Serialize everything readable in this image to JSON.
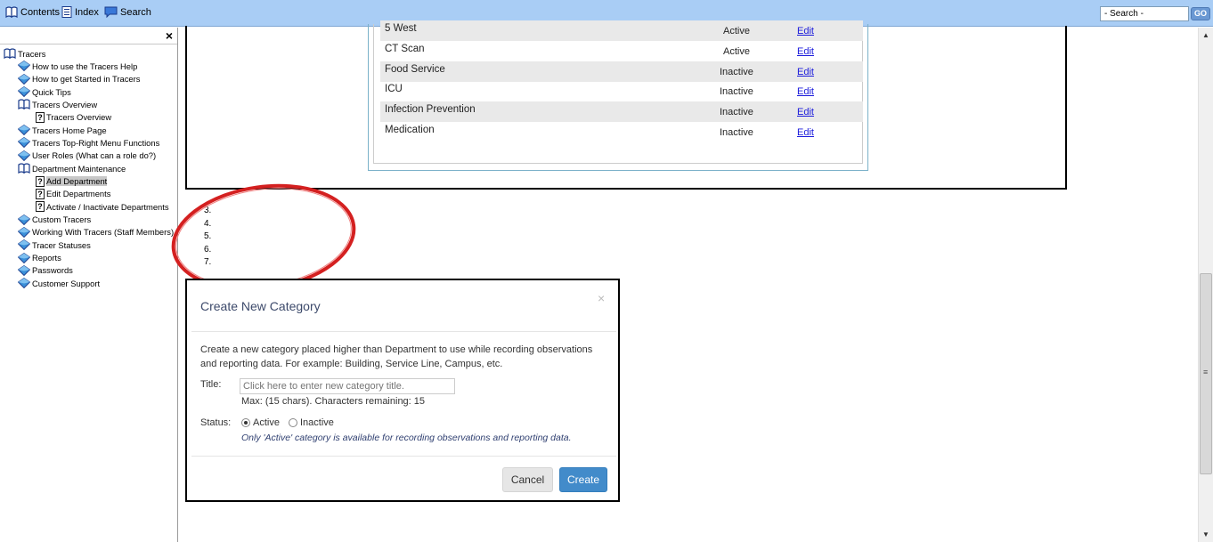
{
  "toolbar": {
    "contents_label": "Contents",
    "index_label": "Index",
    "search_label": "Search",
    "search_placeholder": "- Search -",
    "go_label": "GO"
  },
  "sidebar": {
    "close_label": "×",
    "tree": [
      {
        "label": "Tracers",
        "icon": "open-book-icon",
        "level": 0
      },
      {
        "label": "How to use the Tracers Help",
        "icon": "book-icon",
        "level": 1
      },
      {
        "label": "How to get Started in Tracers",
        "icon": "book-icon",
        "level": 1
      },
      {
        "label": "Quick Tips",
        "icon": "book-icon",
        "level": 1
      },
      {
        "label": "Tracers Overview",
        "icon": "open-book-icon",
        "level": 1
      },
      {
        "label": "Tracers Overview",
        "icon": "help-page-icon",
        "level": 2
      },
      {
        "label": "Tracers Home Page",
        "icon": "book-icon",
        "level": 1
      },
      {
        "label": "Tracers Top-Right Menu Functions",
        "icon": "book-icon",
        "level": 1
      },
      {
        "label": "User Roles (What can a role do?)",
        "icon": "book-icon",
        "level": 1
      },
      {
        "label": "Department Maintenance",
        "icon": "open-book-icon",
        "level": 1
      },
      {
        "label": "Add Department",
        "icon": "help-page-icon",
        "level": 2,
        "selected": true
      },
      {
        "label": "Edit Departments",
        "icon": "help-page-icon",
        "level": 2
      },
      {
        "label": "Activate / Inactivate Departments",
        "icon": "help-page-icon",
        "level": 2
      },
      {
        "label": "Custom Tracers",
        "icon": "book-icon",
        "level": 1
      },
      {
        "label": "Working With Tracers (Staff Members)",
        "icon": "book-icon",
        "level": 1
      },
      {
        "label": "Tracer Statuses",
        "icon": "book-icon",
        "level": 1
      },
      {
        "label": "Reports",
        "icon": "book-icon",
        "level": 1
      },
      {
        "label": "Passwords",
        "icon": "book-icon",
        "level": 1
      },
      {
        "label": "Customer Support",
        "icon": "book-icon",
        "level": 1
      }
    ]
  },
  "departments": {
    "rows": [
      {
        "name": "5 West",
        "status": "Active",
        "action": "Edit"
      },
      {
        "name": "CT Scan",
        "status": "Active",
        "action": "Edit"
      },
      {
        "name": "Food Service",
        "status": "Inactive",
        "action": "Edit"
      },
      {
        "name": "ICU",
        "status": "Inactive",
        "action": "Edit"
      },
      {
        "name": "Infection Prevention",
        "status": "Inactive",
        "action": "Edit"
      },
      {
        "name": "Medication",
        "status": "Inactive",
        "action": "Edit"
      }
    ]
  },
  "steps": [
    "3.",
    "4.",
    "5.",
    "6.",
    "7."
  ],
  "modal": {
    "title": "Create New Category",
    "close_label": "×",
    "description": "Create a new category placed higher than Department to use while recording observations and reporting data. For example: Building, Service Line, Campus, etc.",
    "title_label": "Title:",
    "title_placeholder": "Click here to enter new category title.",
    "max_note": "Max: (15 chars). Characters remaining: 15",
    "status_label": "Status:",
    "status_options": [
      "Active",
      "Inactive"
    ],
    "status_selected": "Active",
    "status_note": "Only 'Active' category is available for recording observations and reporting data.",
    "cancel_label": "Cancel",
    "create_label": "Create"
  },
  "colors": {
    "toolbar_bg": "#a9cdf5",
    "highlight_ellipse": "#d42020",
    "primary_button": "#428bca",
    "link": "#1a1adb"
  }
}
